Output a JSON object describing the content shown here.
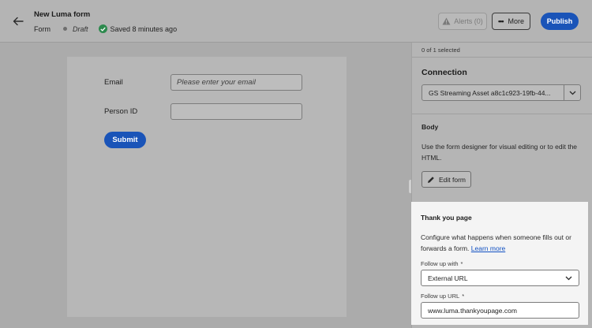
{
  "header": {
    "title": "New Luma form",
    "type_label": "Form",
    "status": "Draft",
    "saved_text": "Saved 8 minutes ago",
    "alerts_label": "Alerts (0)",
    "more_label": "More",
    "publish_label": "Publish"
  },
  "form_preview": {
    "email_label": "Email",
    "email_placeholder": "Please enter your email",
    "person_id_label": "Person ID",
    "submit_label": "Submit"
  },
  "panel": {
    "selected_count": "0 of 1 selected",
    "connection": {
      "title": "Connection",
      "value": "GS Streaming Asset a8c1c923-19fb-44..."
    },
    "body": {
      "title": "Body",
      "description": "Use the form designer for visual editing or to edit the HTML.",
      "edit_button": "Edit form"
    },
    "thank_you": {
      "title": "Thank you page",
      "description": "Configure what happens when someone fills out or forwards a form.",
      "learn_more": "Learn more",
      "follow_up_with_label": "Follow up with",
      "follow_up_with_value": "External URL",
      "follow_up_url_label": "Follow up URL",
      "follow_up_url_value": "www.luma.thankyoupage.com",
      "required_marker": "*"
    }
  },
  "colors": {
    "accent": "#1a54b8",
    "success": "#2d8a4e",
    "link": "#1150c2"
  },
  "icons": {
    "back": "arrow-left-icon",
    "alert": "warning-triangle-icon",
    "more": "ellipsis-icon",
    "saved": "checkmark-circle-icon",
    "edit": "pencil-icon",
    "dropdown": "chevron-down-icon"
  }
}
